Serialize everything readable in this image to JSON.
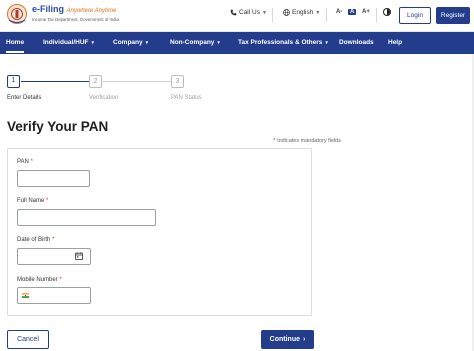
{
  "header": {
    "logo_title": "e-Filing",
    "logo_tagline": "Anywhere Anytime",
    "logo_subtitle": "Income Tax Department, Government of India",
    "call_us": "Call Us",
    "language": "English",
    "font_decrease": "A-",
    "font_normal": "A",
    "font_increase": "A+",
    "login_label": "Login",
    "register_label": "Register"
  },
  "nav": {
    "items": [
      {
        "label": "Home"
      },
      {
        "label": "Individual/HUF"
      },
      {
        "label": "Company"
      },
      {
        "label": "Non-Company"
      },
      {
        "label": "Tax Professionals & Others"
      },
      {
        "label": "Downloads"
      },
      {
        "label": "Help"
      }
    ]
  },
  "stepper": {
    "steps": [
      {
        "number": "1",
        "label": "Enter Details",
        "active": true
      },
      {
        "number": "2",
        "label": "Verification",
        "active": false
      },
      {
        "number": "3",
        "label": "PAN Status",
        "active": false
      }
    ]
  },
  "page": {
    "title": "Verify Your PAN",
    "mandatory_note": "Indicates mandatory fields"
  },
  "form": {
    "pan_label": "PAN",
    "pan_value": "",
    "full_name_label": "Full Name",
    "full_name_value": "",
    "dob_label": "Date of Birth",
    "dob_value": "",
    "mobile_label": "Mobile Number",
    "mobile_value": "",
    "required_marker": "*"
  },
  "actions": {
    "cancel_label": "Cancel",
    "continue_label": "Continue"
  },
  "colors": {
    "primary": "#233d8c",
    "required": "#c0392b",
    "logo_accent": "#e3731c"
  }
}
